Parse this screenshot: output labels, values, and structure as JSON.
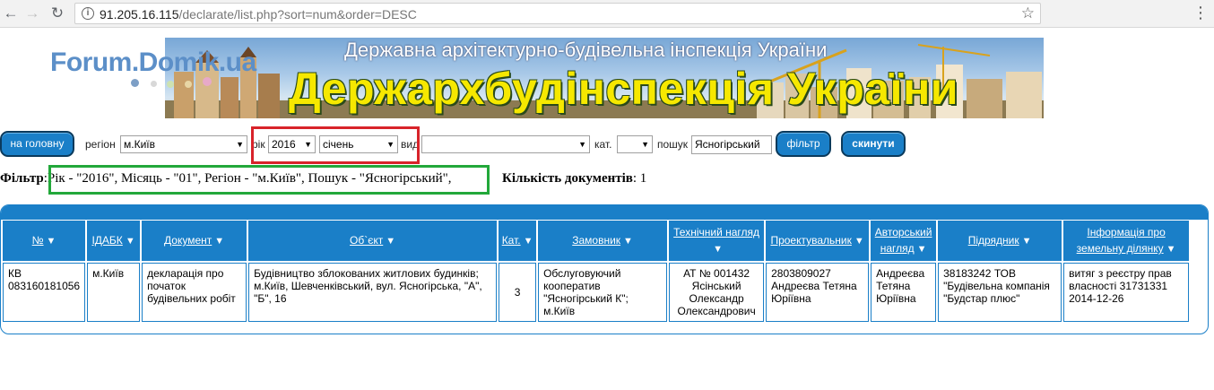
{
  "browser": {
    "url_host": "91.205.16.115",
    "url_path": "/declarate/list.php?sort=num&order=DESC"
  },
  "watermark": {
    "text": "Forum.Domik.ua"
  },
  "banner": {
    "subtitle": "Державна архітектурно-будівельна інспекція України",
    "title": "Держархбудінспекція України"
  },
  "toolbar": {
    "home_button": "на головну",
    "region_label": "регіон",
    "region_value": "м.Київ",
    "year_label": "рік",
    "year_value": "2016",
    "month_value": "січень",
    "type_label": "вид",
    "type_value": "",
    "category_label": "кат.",
    "category_value": "",
    "search_label": "пошук",
    "search_value": "Ясногірський",
    "filter_button": "фільтр",
    "reset_button": "скинути"
  },
  "filter_summary": {
    "label": "Фільтр",
    "text": "Рік - \"2016\", Місяць - \"01\", Регіон - \"м.Київ\", Пошук - \"Ясногірський\",",
    "count_label": "Кількість документів",
    "count_value": ": 1"
  },
  "table": {
    "headers": [
      "№",
      "ІДАБК",
      "Документ",
      "Об`єкт",
      "Кат.",
      "Замовник",
      "Технічний нагляд",
      "Проектувальник",
      "Авторський нагляд",
      "Підрядник",
      "Інформація про земельну ділянку"
    ],
    "rows": [
      {
        "num": "КВ 083160181056",
        "idabk": "м.Київ",
        "document": "декларація про початок будівельних робіт",
        "object": "Будівництво зблокованих житлових будинків; м.Київ, Шевченківський, вул. Ясногірська, \"А\", \"Б\", 16",
        "category": "3",
        "customer": "Обслуговуючий кооператив \"Ясногірський К\"; м.Київ",
        "tech_supervision": "АТ № 001432 Ясінський Олександр Олександрович",
        "designer": "2803809027 Андреєва Тетяна Юріївна",
        "author_supervision": "Андреєва Тетяна Юріївна",
        "contractor": "38183242 ТОВ \"Будівельна компанія \"Будстар плюс\"",
        "land_info": "витяг з реєстру прав власності 31731331 2014-12-26"
      }
    ]
  },
  "colors": {
    "accent": "#1a7fc8",
    "highlight_red": "#d8232a",
    "highlight_green": "#22a83a",
    "banner_title": "#f6e800"
  }
}
